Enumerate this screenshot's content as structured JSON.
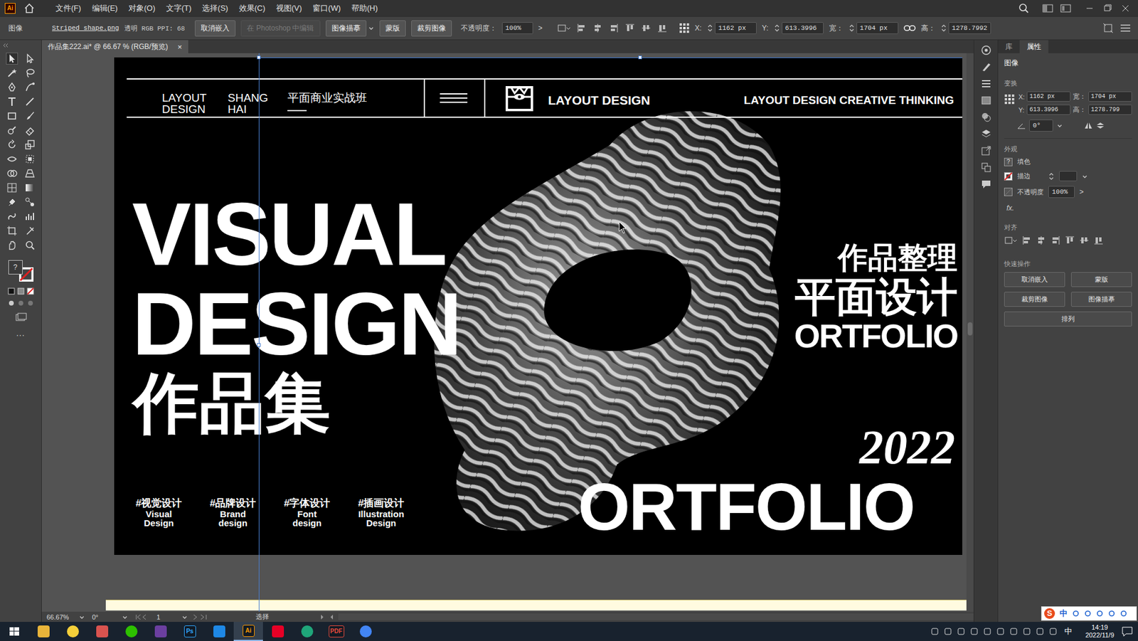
{
  "menubar": {
    "logo": "Ai",
    "items": [
      "文件(F)",
      "编辑(E)",
      "对象(O)",
      "文字(T)",
      "选择(S)",
      "效果(C)",
      "视图(V)",
      "窗口(W)",
      "帮助(H)"
    ]
  },
  "control_bar": {
    "type": "图像",
    "file": "Striped shape.png",
    "mode": "透明 RGB PPI: 68",
    "buttons": [
      {
        "label": "取消嵌入",
        "disabled": false
      },
      {
        "label": "在 Photoshop 中编辑",
        "disabled": true
      },
      {
        "label": "图像描摹",
        "disabled": false
      },
      {
        "label": "蒙版",
        "disabled": false
      },
      {
        "label": "裁剪图像",
        "disabled": false
      }
    ],
    "opacity_label": "不透明度：",
    "opacity": "100%",
    "opacity_more": ">",
    "fields": [
      {
        "label": "X:",
        "value": "1162 px"
      },
      {
        "label": "Y:",
        "value": "613.3996"
      },
      {
        "label": "宽：",
        "value": "1704 px"
      },
      {
        "label": "高：",
        "value": "1278.7992"
      }
    ]
  },
  "document_tab": {
    "title": "作品集222.ai* @ 66.67 % (RGB/预览)",
    "close": "×",
    "selected": true
  },
  "toolbar": {
    "fill": "?",
    "more": "..."
  },
  "artboard": {
    "header": {
      "brand": [
        "LAYOUT",
        "DESIGN"
      ],
      "city": [
        "SHANG",
        "HAI"
      ],
      "course": "平面商业实战班",
      "logo_text": "LAYOUT DESIGN",
      "slogan": "LAYOUT DESIGN CREATIVE THINKING"
    },
    "title": [
      "VISUAL",
      "DESIGN"
    ],
    "subtitle": "作品集",
    "tags": [
      {
        "cn": "#视觉设计",
        "en": [
          "Visual",
          "Design"
        ]
      },
      {
        "cn": "#品牌设计",
        "en": [
          "Brand",
          "design"
        ]
      },
      {
        "cn": "#字体设计",
        "en": [
          "Font",
          "design"
        ]
      },
      {
        "cn": "#插画设计",
        "en": [
          "Illustration",
          "Design"
        ]
      }
    ],
    "right": [
      "作品整理",
      "平面设计",
      "ORTFOLIO"
    ],
    "year": "2022",
    "footer": "ORTFOLIO",
    "image": {
      "selected": true
    }
  },
  "panel": {
    "tabs": [
      {
        "label": "库",
        "selected": false
      },
      {
        "label": "属性",
        "selected": true
      }
    ],
    "object": "图像",
    "transform": {
      "title": "变换",
      "fields": [
        {
          "label": "X:",
          "value": "1162 px"
        },
        {
          "label": "宽：",
          "value": "1704 px"
        },
        {
          "label": "Y:",
          "value": "613.3996"
        },
        {
          "label": "高：",
          "value": "1278.799"
        }
      ],
      "angle": "0°"
    },
    "appearance": {
      "title": "外观",
      "fill_label": "填色",
      "fill": "?",
      "stroke_label": "描边",
      "opacity_label": "不透明度",
      "opacity": "100%",
      "more": ">",
      "fx": "fx."
    },
    "align": {
      "title": "对齐"
    },
    "quick": {
      "title": "快速操作",
      "buttons": [
        "取消嵌入",
        "蒙版",
        "裁剪图像",
        "图像描摹",
        "排列"
      ]
    }
  },
  "status_bar": {
    "zoom": "66.67%",
    "rotation": "0°",
    "page": "1",
    "tool": "选择"
  },
  "taskbar": {
    "apps": [
      {
        "kind": "icon",
        "label": "",
        "color": "#e8b43a",
        "selected": false
      },
      {
        "kind": "icon",
        "label": "",
        "color": "#f4cf3a",
        "selected": false
      },
      {
        "kind": "icon",
        "label": "",
        "color": "#d9534f",
        "selected": false
      },
      {
        "kind": "icon",
        "label": "",
        "color": "#2dc100",
        "selected": false
      },
      {
        "kind": "icon",
        "label": "",
        "color": "#6b3fa0",
        "selected": false
      },
      {
        "kind": "text",
        "label": "Ps",
        "color": "#31a8ff",
        "selected": false
      },
      {
        "kind": "icon",
        "label": "",
        "color": "#1e88e5",
        "selected": false
      },
      {
        "kind": "text",
        "label": "Ai",
        "color": "#ff9a00",
        "selected": true
      },
      {
        "kind": "icon",
        "label": "",
        "color": "#e60026",
        "selected": false
      },
      {
        "kind": "icon",
        "label": "",
        "color": "#1fa67a",
        "selected": false
      },
      {
        "kind": "text",
        "label": "PDF",
        "color": "#e94b3c",
        "selected": false
      },
      {
        "kind": "icon",
        "label": "",
        "color": "#4285f4",
        "selected": false
      }
    ],
    "ime": "中",
    "time": "14:19",
    "date": "2022/11/9"
  },
  "ime_bar": {
    "logo": "S",
    "mode": "中"
  }
}
